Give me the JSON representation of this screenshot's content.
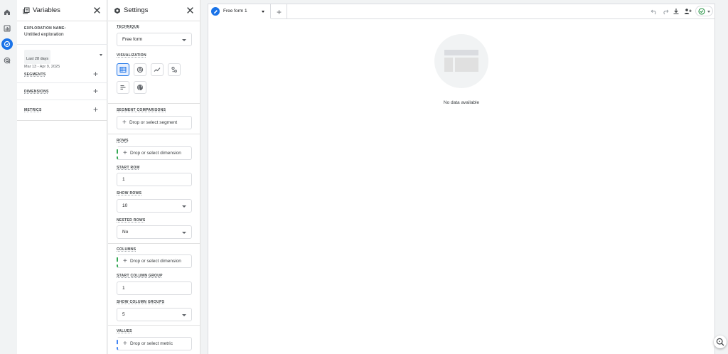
{
  "variables": {
    "title": "Variables",
    "exploration_label": "EXPLORATION NAME:",
    "exploration_name": "Untitled exploration",
    "date_chip": "Last 28 days",
    "date_range": "Mar 13 - Apr 9, 2025",
    "segments_label": "SEGMENTS",
    "dimensions_label": "DIMENSIONS",
    "metrics_label": "METRICS"
  },
  "settings": {
    "title": "Settings",
    "technique_label": "TECHNIQUE",
    "technique_value": "Free form",
    "visualization_label": "VISUALIZATION",
    "segment_comparisons_label": "SEGMENT COMPARISONS",
    "segment_drop": "Drop or select segment",
    "rows_label": "ROWS",
    "rows_drop": "Drop or select dimension",
    "start_row_label": "START ROW",
    "start_row_value": "1",
    "show_rows_label": "SHOW ROWS",
    "show_rows_value": "10",
    "nested_rows_label": "NESTED ROWS",
    "nested_rows_value": "No",
    "columns_label": "COLUMNS",
    "columns_drop": "Drop or select dimension",
    "start_column_group_label": "START COLUMN GROUP",
    "start_column_group_value": "1",
    "show_column_groups_label": "SHOW COLUMN GROUPS",
    "show_column_groups_value": "5",
    "values_label": "VALUES",
    "values_drop": "Drop or select metric"
  },
  "canvas": {
    "tab_label": "Free form 1",
    "empty_message": "No data available"
  },
  "colors": {
    "accent": "#1a73e8",
    "rows_dash": "#34a853",
    "values_dash": "#4285f4",
    "status_ok": "#1e8e3e"
  }
}
